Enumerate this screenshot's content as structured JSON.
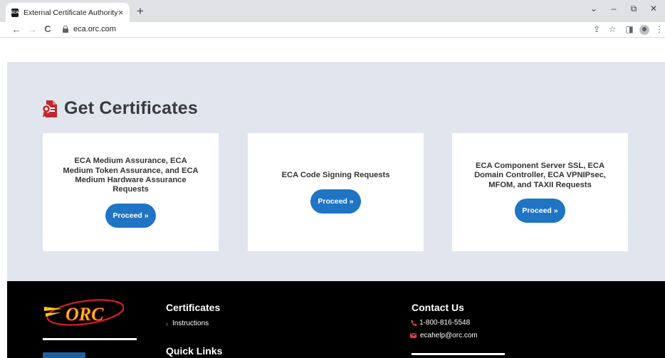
{
  "browser": {
    "tab_title": "External Certificate Authority",
    "favicon_text": "ECA",
    "tab_close": "×",
    "new_tab": "+",
    "url": "eca.orc.com",
    "window_controls": {
      "dropdown": "⌄",
      "minimize": "–",
      "restore": "⧉",
      "close": "✕"
    },
    "nav": {
      "back": "←",
      "forward": "→",
      "reload": "C"
    },
    "toolbar_icons": {
      "share": "⇪",
      "star": "☆",
      "sidepanel": "◨",
      "menu": "⋮"
    }
  },
  "section": {
    "title": "Get Certificates",
    "icon": "certificate-icon",
    "accent_color": "#c0282d"
  },
  "cards": [
    {
      "title": "ECA Medium Assurance, ECA Medium Token Assurance, and ECA Medium Hardware Assurance Requests",
      "button": "Proceed »"
    },
    {
      "title": "ECA Code Signing Requests",
      "button": "Proceed »"
    },
    {
      "title": "ECA Component Server SSL, ECA Domain Controller, ECA VPNIPsec, MFOM, and TAXII Requests",
      "button": "Proceed »"
    }
  ],
  "footer": {
    "logo_text": "ORC",
    "certificates_heading": "Certificates",
    "certificates_links": [
      "Instructions"
    ],
    "quick_links_heading": "Quick Links",
    "contact_heading": "Contact Us",
    "phone": "1-800-816-5548",
    "email": "ecahelp@orc.com"
  },
  "colors": {
    "page_band": "#e1e6ee",
    "button": "#1f74c4",
    "footer": "#000000",
    "logo_red": "#d61f26",
    "logo_yellow": "#f5c518"
  }
}
